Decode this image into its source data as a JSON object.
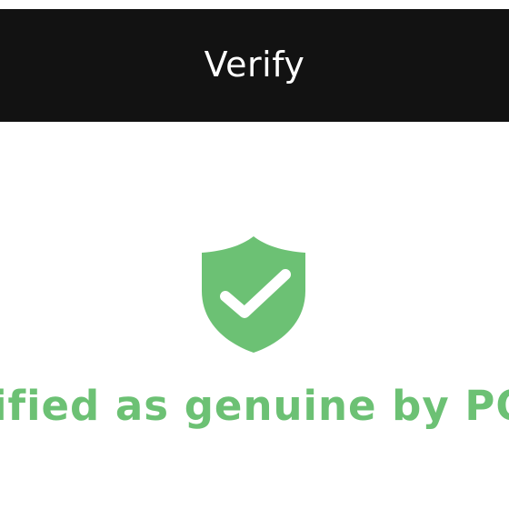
{
  "colors": {
    "header_bg": "#121212",
    "header_text": "#ffffff",
    "accent_green": "#6cc174",
    "background": "#ffffff"
  },
  "header": {
    "title": "Verify"
  },
  "status": {
    "icon": "shield-check-icon",
    "message": "Verified as genuine by POPMART"
  }
}
